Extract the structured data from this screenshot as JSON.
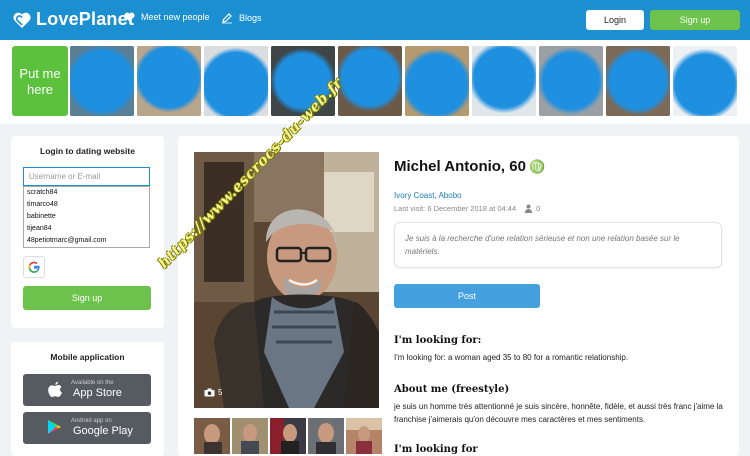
{
  "header": {
    "logo_text": "LovePlanet",
    "nav": [
      {
        "label": "Meet new people",
        "icon": "heart-icon"
      },
      {
        "label": "Blogs",
        "icon": "pencil-icon"
      }
    ],
    "login_label": "Login",
    "signup_label": "Sign up"
  },
  "strip": {
    "put_me_here": "Put me here"
  },
  "login_card": {
    "title": "Login to dating website",
    "placeholder": "Username or E-mail",
    "suggestions": [
      "scratch84",
      "timarco48",
      "babinette",
      "tijean84",
      "48petiotmarc@gmail.com"
    ],
    "signup_label": "Sign up"
  },
  "mobile_card": {
    "title": "Mobile application",
    "appstore_small": "Available on the",
    "appstore_big": "App Store",
    "googleplay_small": "Android app on",
    "googleplay_big": "Google Play"
  },
  "profile": {
    "name": "Michel Antonio, 60",
    "zodiac": "♍",
    "location": "Ivory Coast, Abobo",
    "last_visit": "Last visit: 6 December 2018 at 04:44",
    "views": "0",
    "photo_count": "5",
    "quote": "Je suis à la recherche d'une relation sérieuse et non une relation basée sur le matériels.",
    "post_label": "Post",
    "looking_title": "I'm looking for:",
    "looking_text": "I'm looking for: a woman aged 35 to 80 for a romantic relationship.",
    "about_title": "About me (freestyle)",
    "about_text": "je suis un homme très attentionné je suis sincère, honnête, fidèle, et aussi très franc j'aime la franchise j'aimerais qu'on découvre mes caractères et mes sentiments.",
    "looking_title_2": "I'm looking for"
  },
  "watermark": "https://www.escrocs-du-web.fr",
  "colors": {
    "header_blue": "#1b8fd0",
    "green": "#6cc24a",
    "post_blue": "#45a0e0",
    "watermark_yellow": "#f5f58a"
  }
}
